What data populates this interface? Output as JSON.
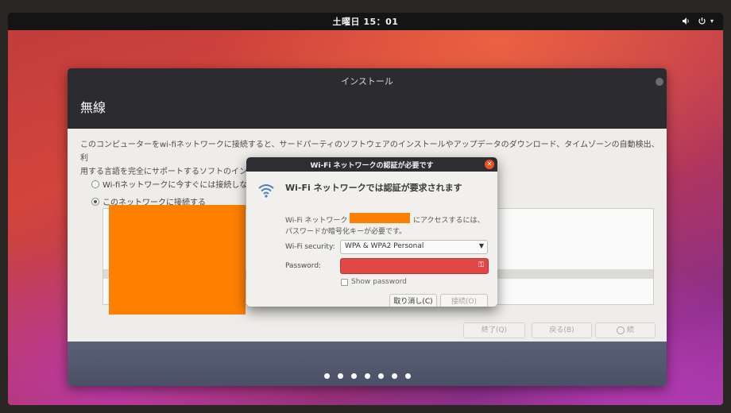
{
  "topbar": {
    "clock": "土曜日 15：01",
    "icons": [
      "speaker-icon",
      "power-icon",
      "chevron-down-icon"
    ]
  },
  "installer": {
    "title": "インストール",
    "heading": "無線",
    "description_line1": "このコンピューターをwi-fiネットワークに接続すると、サードパーティのソフトウェアのインストールやアップデータのダウンロード、タイムゾーンの自動検出、利",
    "description_line2": "用する言語を完全にサポートするソフトのイン",
    "option_no_connect": "Wi-fiネットワークに今すぐには接続しな",
    "option_connect": "このネットワークに接続する",
    "selected_option": "option_connect",
    "buttons": {
      "quit": "終了(Q)",
      "back": "戻る(B)",
      "continue": "続"
    },
    "progress_dots": 7,
    "accent_color": "#e95420"
  },
  "dialog": {
    "title": "Wi-Fi ネットワークの認証が必要です",
    "heading": "Wi-Fi ネットワークでは認証が要求されます",
    "message_prefix": "Wi-Fi ネットワーク",
    "message_suffix": "にアクセスするには、",
    "message_line2": "パスワードか暗号化キーが必要です。",
    "security_label": "Wi-Fi security:",
    "security_value": "WPA & WPA2 Personal",
    "password_label": "Password:",
    "password_value": "",
    "show_password_label": "Show password",
    "show_password_checked": false,
    "cancel_button": "取り消し(C)",
    "connect_button": "接続(O)"
  }
}
